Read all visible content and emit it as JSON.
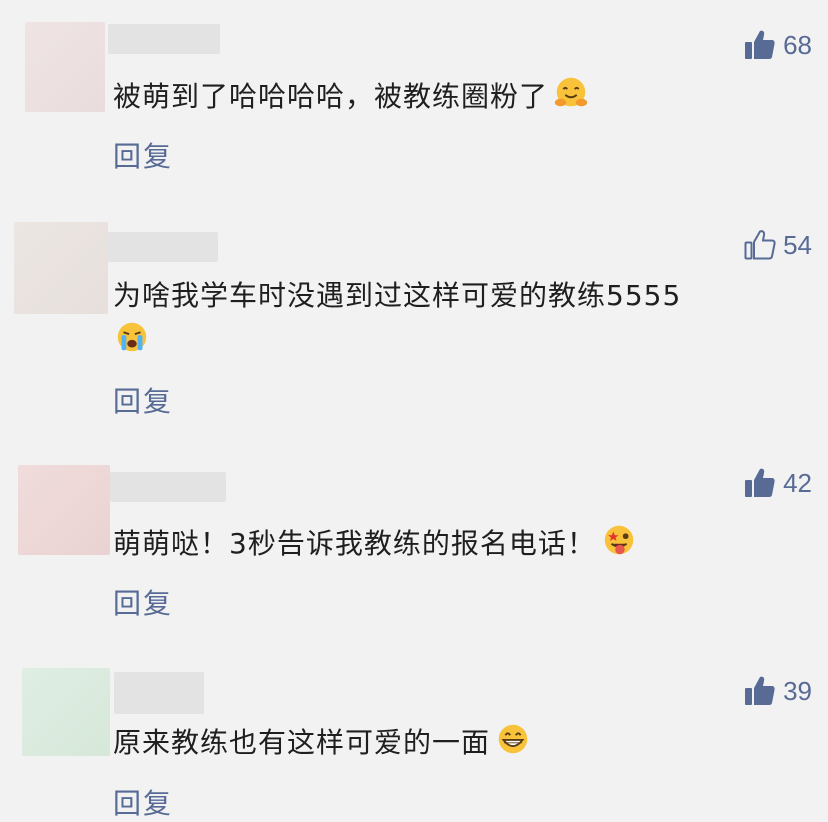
{
  "comments": [
    {
      "likes": "68",
      "text": "被萌到了哈哈哈哈，被教练圈粉了",
      "emoji": "hugging-face",
      "reply": "回复",
      "liked": true
    },
    {
      "likes": "54",
      "text_line1": "为啥我学车时没遇到过这样可爱的教练5555",
      "emoji": "loudly-crying-face",
      "reply": "回复",
      "liked": false
    },
    {
      "likes": "42",
      "text": "萌萌哒！3秒告诉我教练的报名电话！",
      "emoji": "star-struck-tongue-face",
      "reply": "回复",
      "liked": true
    },
    {
      "likes": "39",
      "text": "原来教练也有这样可爱的一面",
      "emoji": "grinning-face",
      "reply": "回复",
      "liked": true
    }
  ],
  "colors": {
    "background": "#f2f2f2",
    "link": "#576b95",
    "text": "#1f1f1f"
  }
}
